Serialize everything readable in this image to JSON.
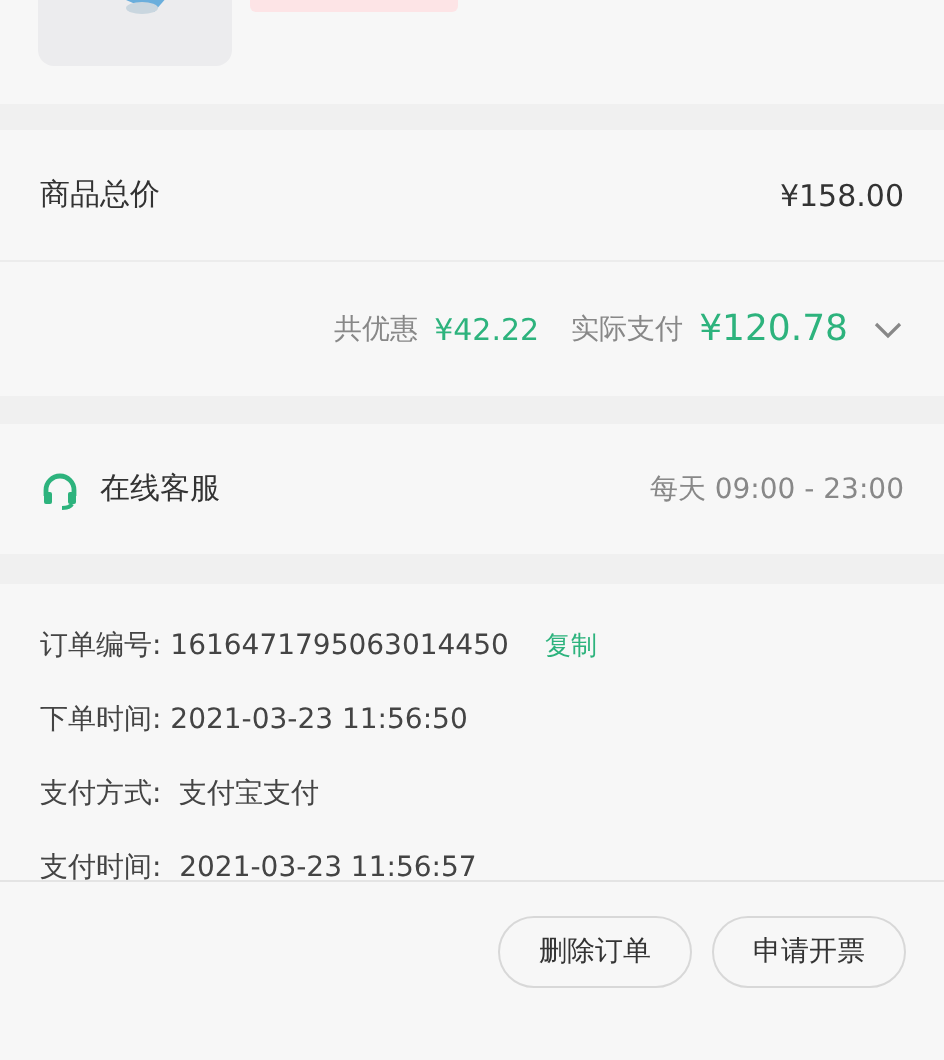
{
  "product": {
    "tag": {
      "kind": "tag"
    }
  },
  "price": {
    "total_label": "商品总价",
    "total_value": "¥158.00",
    "discount_label": "共优惠",
    "discount_value": "¥42.22",
    "paid_label": "实际支付",
    "paid_value": "¥120.78",
    "expanded": false
  },
  "service": {
    "label": "在线客服",
    "hours": "每天 09:00 - 23:00"
  },
  "order_info": [
    {
      "text": "订单编号: 1616471795063014450",
      "action": "复制"
    },
    {
      "text": "下单时间: 2021-03-23 11:56:50"
    },
    {
      "text": "支付方式:  支付宝支付"
    },
    {
      "text": "支付时间:  2021-03-23 11:56:57"
    }
  ],
  "buttons": [
    "删除订单",
    "申请开票"
  ]
}
